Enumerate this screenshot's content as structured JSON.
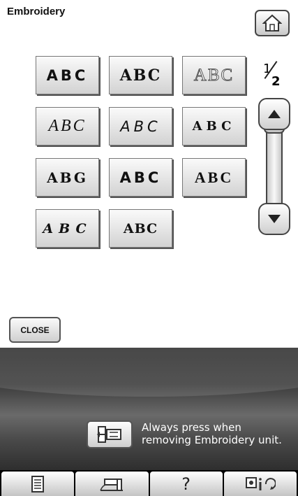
{
  "header": {
    "title": "Embroidery"
  },
  "fonts": [
    {
      "label": "ABC",
      "style": "sans-bold"
    },
    {
      "label": "ABC",
      "style": "serif-bold"
    },
    {
      "label": "ABC",
      "style": "outline"
    },
    {
      "label": "ABC",
      "style": "script"
    },
    {
      "label": "ABC",
      "style": "italic-light"
    },
    {
      "label": "ABC",
      "style": "stencil"
    },
    {
      "label": "ABG",
      "style": "heavy-serif"
    },
    {
      "label": "ABC",
      "style": "broken"
    },
    {
      "label": "ABC",
      "style": "blocky"
    },
    {
      "label": "ABC",
      "style": "italic-serif"
    },
    {
      "label": "ABC",
      "style": "blackletter"
    }
  ],
  "pagination": {
    "current": "1",
    "total": "2"
  },
  "close_label": "CLOSE",
  "message": {
    "line1": "Always press when",
    "line2": "removing Embroidery unit."
  },
  "bottom_bar": {
    "help_label": "?"
  }
}
